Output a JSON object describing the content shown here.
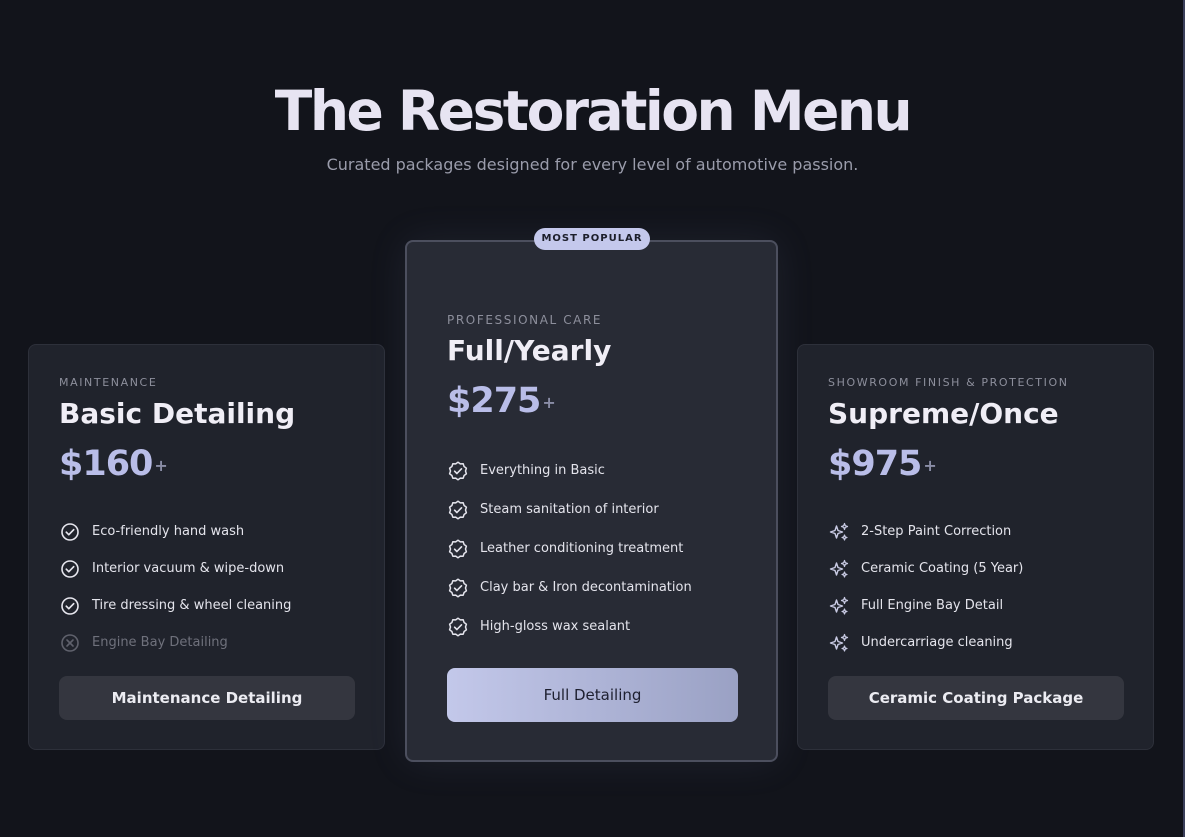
{
  "header": {
    "title": "The Restoration Menu",
    "subtitle": "Curated packages designed for every level of automotive passion."
  },
  "colors": {
    "background": "#12141b",
    "accent": "#c4c8ec",
    "price": "#b9bde8"
  },
  "plans": [
    {
      "eyebrow": "MAINTENANCE",
      "name": "Basic Detailing",
      "price": "$160",
      "price_suffix": "+",
      "features": [
        {
          "label": "Eco-friendly hand wash",
          "icon": "check-circle-icon",
          "included": true
        },
        {
          "label": "Interior vacuum & wipe-down",
          "icon": "check-circle-icon",
          "included": true
        },
        {
          "label": "Tire dressing & wheel cleaning",
          "icon": "check-circle-icon",
          "included": true
        },
        {
          "label": "Engine Bay Detailing",
          "icon": "x-circle-icon",
          "included": false
        }
      ],
      "cta": "Maintenance Detailing"
    },
    {
      "badge": "MOST POPULAR",
      "eyebrow": "PROFESSIONAL CARE",
      "name": "Full/Yearly",
      "price": "$275",
      "price_suffix": "+",
      "features": [
        {
          "label": "Everything in Basic",
          "icon": "badge-check-icon",
          "included": true
        },
        {
          "label": "Steam sanitation of interior",
          "icon": "badge-check-icon",
          "included": true
        },
        {
          "label": "Leather conditioning treatment",
          "icon": "badge-check-icon",
          "included": true
        },
        {
          "label": "Clay bar & Iron decontamination",
          "icon": "badge-check-icon",
          "included": true
        },
        {
          "label": "High-gloss wax sealant",
          "icon": "badge-check-icon",
          "included": true
        }
      ],
      "cta": "Full Detailing"
    },
    {
      "eyebrow": "SHOWROOM FINISH & PROTECTION",
      "name": "Supreme/Once",
      "price": "$975",
      "price_suffix": "+",
      "features": [
        {
          "label": "2-Step Paint Correction",
          "icon": "sparkles-icon",
          "included": true
        },
        {
          "label": "Ceramic Coating (5 Year)",
          "icon": "sparkles-icon",
          "included": true
        },
        {
          "label": "Full Engine Bay Detail",
          "icon": "sparkles-icon",
          "included": true
        },
        {
          "label": "Undercarriage cleaning",
          "icon": "sparkles-icon",
          "included": true
        }
      ],
      "cta": "Ceramic Coating Package"
    }
  ]
}
